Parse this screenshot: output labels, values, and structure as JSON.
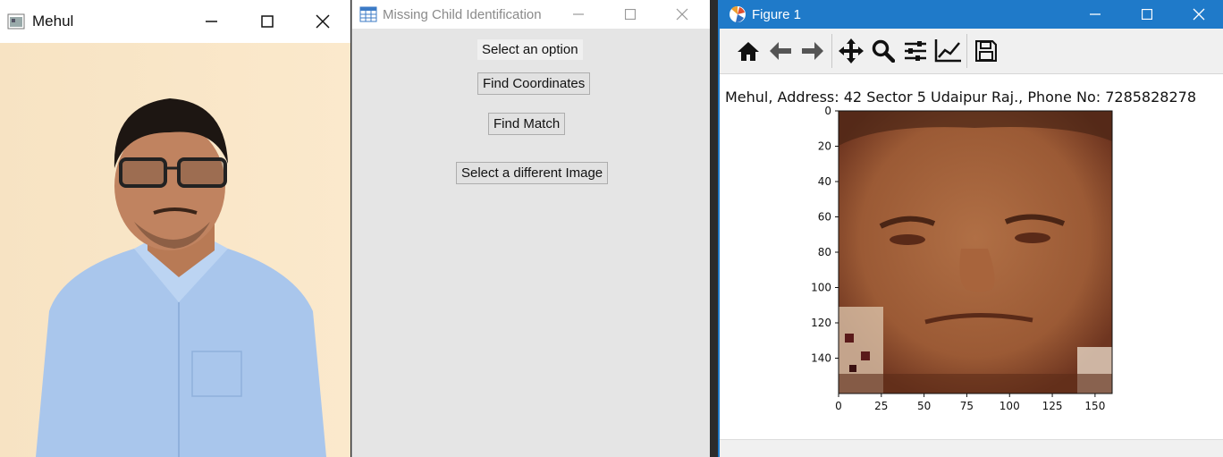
{
  "photo_window": {
    "title": "Mehul"
  },
  "menu_window": {
    "title": "Missing Child Identification",
    "prompt": "Select an option",
    "buttons": {
      "find_coordinates": "Find Coordinates",
      "find_match": "Find Match",
      "select_image": "Select a different Image"
    }
  },
  "figure_window": {
    "title": "Figure 1",
    "toolbar": [
      "home-icon",
      "back-arrow-icon",
      "forward-arrow-icon",
      "pan-icon",
      "zoom-icon",
      "configure-subplots-icon",
      "edit-axes-icon",
      "save-icon"
    ],
    "plot_title": "Mehul, Address: 42 Sector 5 Udaipur Raj., Phone No: 7285828278"
  },
  "chart_data": {
    "type": "heatmap",
    "title": "Mehul, Address: 42 Sector 5 Udaipur Raj., Phone No: 7285828278",
    "x_ticks": [
      "0",
      "25",
      "50",
      "75",
      "100",
      "125",
      "150"
    ],
    "y_ticks": [
      "0",
      "20",
      "40",
      "60",
      "80",
      "100",
      "120",
      "140"
    ],
    "xlim": [
      0,
      160
    ],
    "ylim": [
      160,
      0
    ],
    "colors": {
      "skin": "#a0603a",
      "shadow": "#6b3520",
      "hair": "#4a2515"
    }
  }
}
